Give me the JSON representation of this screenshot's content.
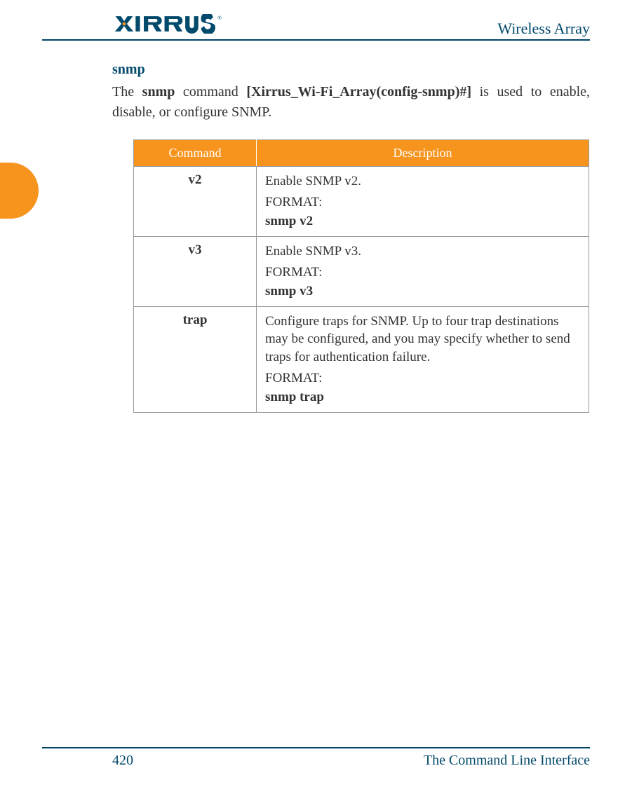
{
  "header": {
    "logo_text": "XIRRUS",
    "title": "Wireless Array"
  },
  "section": {
    "title": "snmp",
    "intro_prefix": "The ",
    "intro_cmd": "snmp",
    "intro_mid": " command ",
    "intro_prompt": "[Xirrus_Wi-Fi_Array(config-snmp)#]",
    "intro_suffix": " is used to enable, disable, or configure SNMP."
  },
  "table": {
    "headers": {
      "command": "Command",
      "description": "Description"
    },
    "rows": [
      {
        "command": "v2",
        "description": "Enable SNMP v2.",
        "format_label": "FORMAT:",
        "format": "snmp v2"
      },
      {
        "command": "v3",
        "description": "Enable SNMP v3.",
        "format_label": "FORMAT:",
        "format": "snmp v3"
      },
      {
        "command": "trap",
        "description": "Configure traps for SNMP. Up to four trap destinations may be configured, and you may specify whether to send traps for authentication failure.",
        "format_label": "FORMAT:",
        "format": "snmp trap"
      }
    ]
  },
  "footer": {
    "page": "420",
    "chapter": "The Command Line Interface"
  },
  "colors": {
    "accent": "#f7941e",
    "ink": "#024a6c"
  }
}
